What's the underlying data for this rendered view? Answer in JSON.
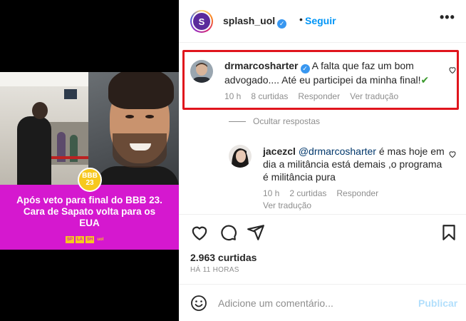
{
  "media": {
    "badge_line1": "BBB",
    "badge_line2": "23",
    "headline": "Após veto para final do BBB 23. Cara de Sapato volta para os EUA",
    "brand_letters": [
      "SP",
      "LA",
      "SH"
    ],
    "brand_suffix": "uol"
  },
  "header": {
    "avatar_letter": "S",
    "username": "splash_uol",
    "verified_mark": "✓",
    "dot": "•",
    "follow_label": "Seguir",
    "more_label": "•••"
  },
  "comments": [
    {
      "username": "drmarcosharter",
      "verified_mark": "✓",
      "text": "A falta que faz um bom advogado.... Até eu participei da minha final!",
      "emoji": "✔",
      "time": "10 h",
      "likes": "8 curtidas",
      "reply": "Responder",
      "translate": "Ver tradução"
    },
    {
      "username": "jacezcl",
      "mention": "@drmarcosharter",
      "text": "é mas hoje em dia a militância está demais ,o programa é militância pura",
      "time": "10 h",
      "likes": "2 curtidas",
      "reply": "Responder",
      "translate": "Ver tradução"
    }
  ],
  "hide_replies": "Ocultar respostas",
  "footer": {
    "likes": "2.963 curtidas",
    "time_ago": "HÁ 11 HORAS",
    "comment_placeholder": "Adicione um comentário...",
    "publish_label": "Publicar"
  },
  "colors": {
    "banner": "#d518cf",
    "badge": "#f7c81e",
    "follow": "#0095f6",
    "highlight": "#e0151d",
    "check": "#3c9a2e"
  }
}
